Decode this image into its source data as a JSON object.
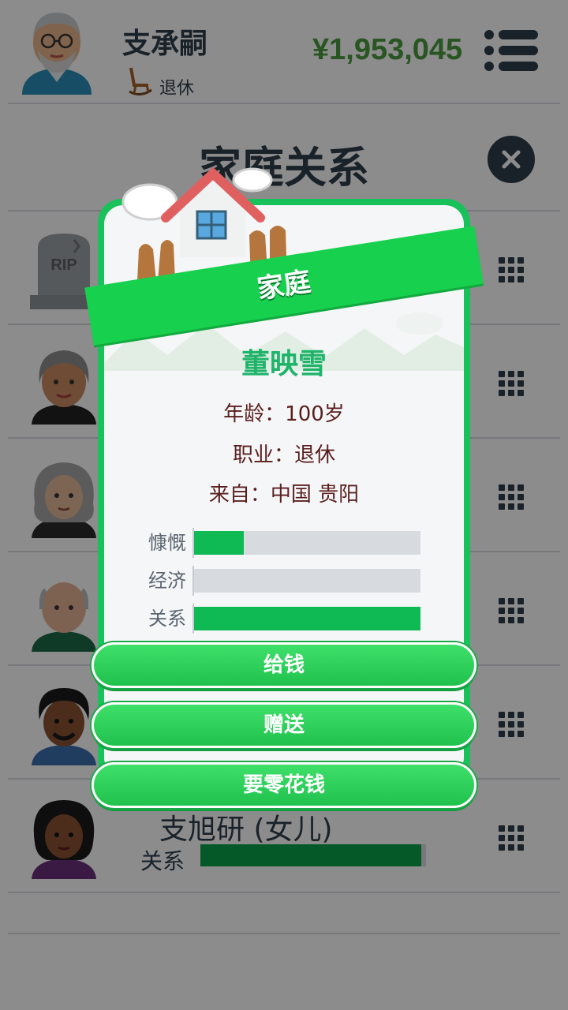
{
  "player": {
    "name": "支承嗣",
    "status": "退休",
    "money": "¥1,953,045"
  },
  "family_page": {
    "title": "家庭关系",
    "members": [
      {
        "kind": "deceased",
        "rip": "RIP"
      },
      {
        "kind": "grandma"
      },
      {
        "kind": "old-woman"
      },
      {
        "kind": "old-man"
      },
      {
        "kind": "man-curly"
      },
      {
        "kind": "daughter",
        "name": "支旭研 (女儿)",
        "relation_label": "关系",
        "relation_level": 0.98
      }
    ]
  },
  "modal": {
    "banner": "家庭",
    "name": "董映雪",
    "age_line": "年龄：100岁",
    "job_line": "职业：退休",
    "from_line": "来自：中国 贵阳",
    "stats": [
      {
        "label": "慷慨",
        "value": 0.22
      },
      {
        "label": "经济",
        "value": 0.0
      },
      {
        "label": "关系",
        "value": 1.0
      }
    ],
    "buttons": {
      "give_money": "给钱",
      "gift": "赠送",
      "ask_allowance": "要零花钱"
    }
  },
  "colors": {
    "accent_green": "#19c15a",
    "money_green": "#4a9b3e",
    "dark_navy": "#2f3d4c",
    "name_green": "#1fb46a"
  }
}
